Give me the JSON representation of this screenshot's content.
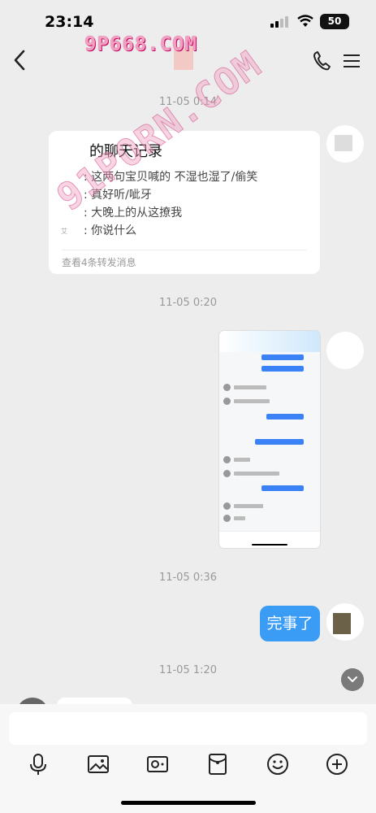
{
  "status_bar": {
    "time": "23:14",
    "battery": "50"
  },
  "watermark": {
    "top": "9P668.COM",
    "diagonal": "91PORN.COM"
  },
  "messages": {
    "ts1": "11-05 0:14",
    "forward": {
      "title": "的聊天记录",
      "lines": [
        ": 这两句宝贝喊的 不湿也湿了/偷笑",
        ": 真好听/呲牙",
        ": 大晚上的从这撩我",
        ": 你说什么"
      ],
      "small": "艾",
      "footer": "查看4条转发消息"
    },
    "ts2": "11-05 0:20",
    "ts3": "11-05 0:36",
    "done": "完事了",
    "ts4": "11-05 1:20"
  },
  "icons": {
    "nav": [
      "back-icon",
      "phone-icon",
      "menu-icon"
    ],
    "toolbar": [
      "microphone-icon",
      "image-icon",
      "camera-icon",
      "red-packet-icon",
      "emoji-icon",
      "plus-icon"
    ]
  },
  "colors": {
    "bubble_blue": "#3b9cf6",
    "background": "#ededed"
  }
}
